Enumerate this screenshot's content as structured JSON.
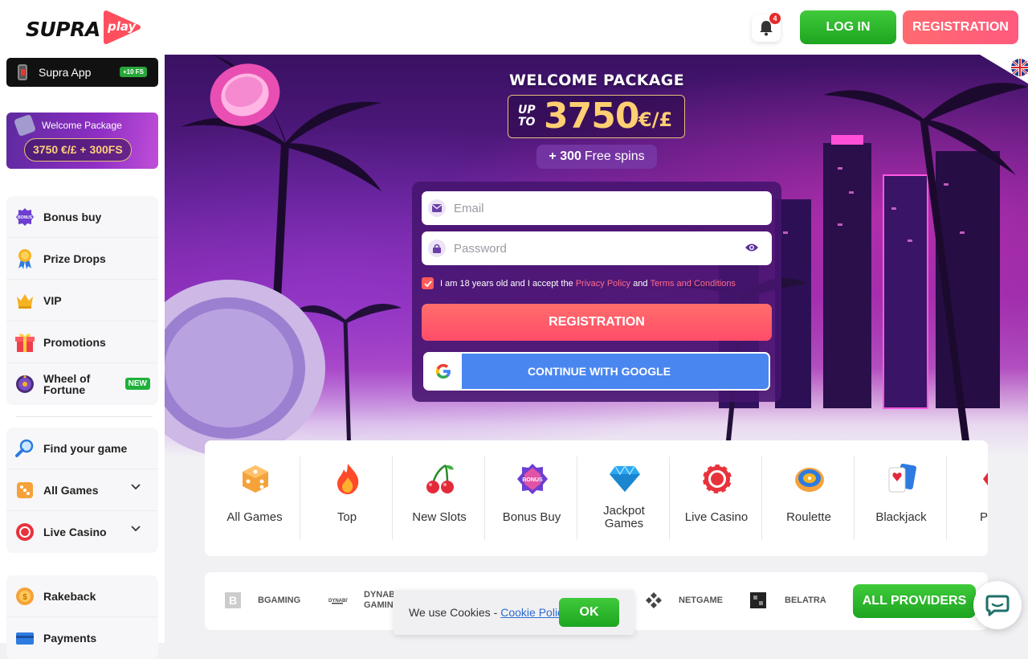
{
  "header": {
    "logo_text": "SUPRA",
    "logo_badge": "play",
    "notification_count": "4",
    "login_label": "LOG IN",
    "registration_label": "REGISTRATION"
  },
  "sidebar": {
    "app": {
      "label": "Supra App",
      "badge": "+10 FS"
    },
    "welcome": {
      "title": "Welcome Package",
      "amount": "3750 €/£ + 300FS"
    },
    "group1": [
      {
        "label": "Bonus buy",
        "icon": "bonus-buy-icon"
      },
      {
        "label": "Prize Drops",
        "icon": "prize-drops-icon"
      },
      {
        "label": "VIP",
        "icon": "crown-icon"
      },
      {
        "label": "Promotions",
        "icon": "gift-icon"
      },
      {
        "label": "Wheel of Fortune",
        "label_line1": "Wheel of",
        "label_line2": "Fortune",
        "badge": "NEW",
        "icon": "wheel-icon"
      }
    ],
    "group2": [
      {
        "label": "Find your game",
        "icon": "search-icon"
      },
      {
        "label": "All Games",
        "icon": "dice-icon"
      },
      {
        "label": "Live Casino",
        "icon": "chip-icon"
      }
    ],
    "group3": [
      {
        "label": "Rakeback",
        "icon": "coin-icon"
      },
      {
        "label": "Payments",
        "icon": "card-icon"
      }
    ]
  },
  "hero": {
    "title": "WELCOME PACKAGE",
    "up_to_line1": "UP",
    "up_to_line2": "TO",
    "amount": "3750",
    "currency": "€/£",
    "free_spins_number": "+ 300",
    "free_spins_text": "Free spins",
    "form": {
      "email_placeholder": "Email",
      "password_placeholder": "Password",
      "consent_text": "I am 18 years old and I accept the",
      "privacy_link": "Privacy Policy",
      "and_text": "and",
      "terms_link": "Terms and Conditions",
      "registration_label": "REGISTRATION",
      "google_label": "CONTINUE WITH GOOGLE"
    }
  },
  "categories": [
    {
      "label": "All Games",
      "icon": "dice-icon"
    },
    {
      "label": "Top",
      "icon": "fire-icon"
    },
    {
      "label": "New Slots",
      "icon": "cherry-icon"
    },
    {
      "label": "Bonus Buy",
      "icon": "bonus-buy-icon"
    },
    {
      "label_line1": "Jackpot",
      "label_line2": "Games",
      "label": "Jackpot Games",
      "icon": "diamond-icon"
    },
    {
      "label": "Live Casino",
      "icon": "chip-icon"
    },
    {
      "label": "Roulette",
      "icon": "roulette-icon"
    },
    {
      "label": "Blackjack",
      "icon": "cards-icon"
    },
    {
      "label": "P",
      "icon": "poker-icon"
    }
  ],
  "providers": [
    {
      "name": "BGAMING"
    },
    {
      "name": "DYNABI GAMIN",
      "name_line1": "DYNABI",
      "name_line2": "GAMIN"
    },
    {
      "name": "NETGAME"
    },
    {
      "name": "BELATRA"
    }
  ],
  "all_providers_label": "ALL PROVIDERS",
  "cookie": {
    "text": "We use Cookies -",
    "link": "Cookie Policy",
    "ok": "OK"
  },
  "colors": {
    "accent_green": "#1ea521",
    "accent_coral": "#ff5a6e",
    "google_blue": "#4a86ef"
  }
}
